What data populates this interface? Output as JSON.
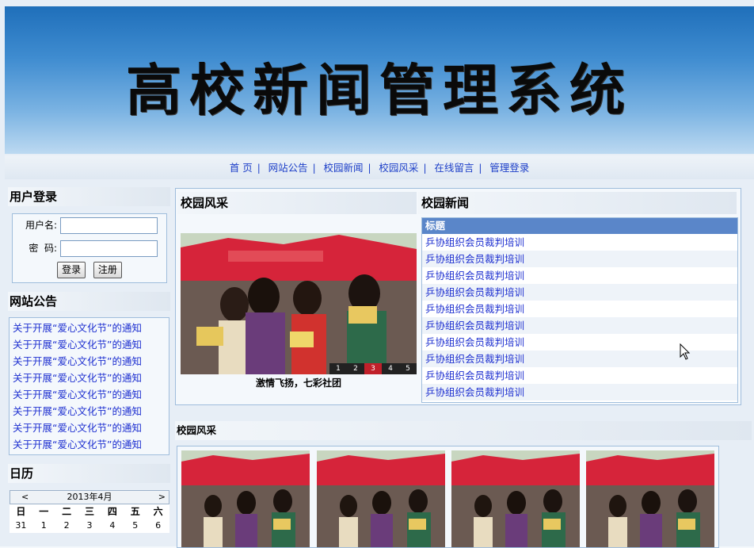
{
  "site": {
    "title": "高校新闻管理系统"
  },
  "nav": {
    "items": [
      "首 页",
      "网站公告",
      "校园新闻",
      "校园风采",
      "在线留言",
      "管理登录"
    ]
  },
  "login": {
    "heading": "用户登录",
    "username_label": "用户名:",
    "password_label": "密  码:",
    "login_button": "登录",
    "register_button": "注册"
  },
  "notice": {
    "heading": "网站公告",
    "items": [
      "关于开展“爱心文化节”的通知",
      "关于开展“爱心文化节”的通知",
      "关于开展“爱心文化节”的通知",
      "关于开展“爱心文化节”的通知",
      "关于开展“爱心文化节”的通知",
      "关于开展“爱心文化节”的通知",
      "关于开展“爱心文化节”的通知",
      "关于开展“爱心文化节”的通知"
    ]
  },
  "calendar": {
    "heading": "日历",
    "prev": "<",
    "next": ">",
    "month": "2013年4月",
    "weekdays": [
      "日",
      "一",
      "二",
      "三",
      "四",
      "五",
      "六"
    ],
    "first_row": [
      "31",
      "1",
      "2",
      "3",
      "4",
      "5",
      "6"
    ]
  },
  "campus": {
    "heading": "校园风采",
    "caption": "激情飞扬，七彩社团",
    "slides": [
      "1",
      "2",
      "3",
      "4",
      "5"
    ],
    "active_slide": "3"
  },
  "news": {
    "heading": "校园新闻",
    "column": "标题",
    "items": [
      "乒协组织会员裁判培训",
      "乒协组织会员裁判培训",
      "乒协组织会员裁判培训",
      "乒协组织会员裁判培训",
      "乒协组织会员裁判培训",
      "乒协组织会员裁判培训",
      "乒协组织会员裁判培训",
      "乒协组织会员裁判培训",
      "乒协组织会员裁判培训",
      "乒协组织会员裁判培训"
    ]
  },
  "gallery": {
    "heading": "校园风采"
  },
  "colors": {
    "link": "#1d2fd0",
    "accent": "#5a86c9",
    "border": "#9fbddc"
  }
}
